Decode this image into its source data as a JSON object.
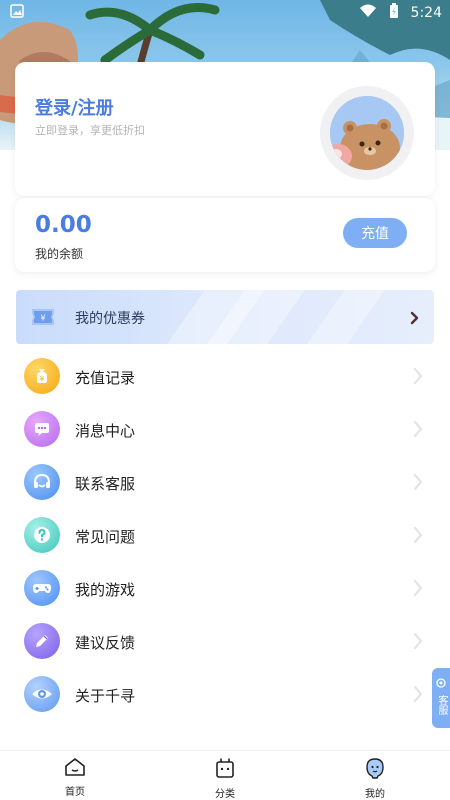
{
  "status_bar": {
    "time": "5:24"
  },
  "login": {
    "title": "登录/注册",
    "subtitle": "立即登录，享更低折扣"
  },
  "balance": {
    "value": "0.00",
    "label": "我的余额",
    "button_label": "充值"
  },
  "coupon": {
    "label": "我的优惠券",
    "icon": "coupon-ticket-icon"
  },
  "menu": {
    "items": [
      {
        "label": "充值记录",
        "icon": "money-bag-icon",
        "color": "#f7b21c"
      },
      {
        "label": "消息中心",
        "icon": "message-icon",
        "color": "#c77ef0"
      },
      {
        "label": "联系客服",
        "icon": "headset-icon",
        "color": "#5d9df0"
      },
      {
        "label": "常见问题",
        "icon": "question-icon",
        "color": "#4fd0c8"
      },
      {
        "label": "我的游戏",
        "icon": "gamepad-icon",
        "color": "#5b9cf2"
      },
      {
        "label": "建议反馈",
        "icon": "pencil-icon",
        "color": "#8d74ee"
      },
      {
        "label": "关于千寻",
        "icon": "eye-icon",
        "color": "#6aa4f0"
      }
    ]
  },
  "service_tab": {
    "label": "客服"
  },
  "bottom_nav": {
    "items": [
      {
        "label": "首页",
        "icon": "home-icon"
      },
      {
        "label": "分类",
        "icon": "category-icon"
      },
      {
        "label": "我的",
        "icon": "profile-icon",
        "active": true
      }
    ]
  },
  "colors": {
    "accent": "#4a7de0",
    "button": "#7eaef3"
  }
}
